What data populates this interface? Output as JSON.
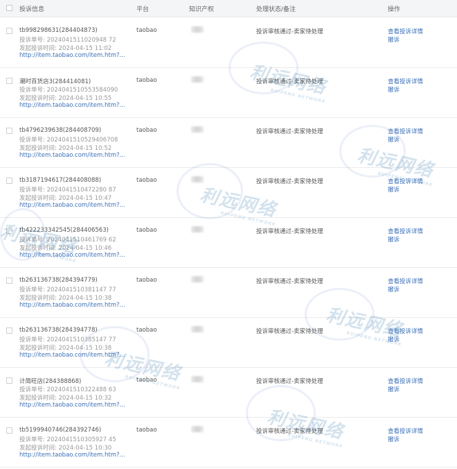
{
  "header": {
    "col_info": "投诉信息",
    "col_platform": "平台",
    "col_ip": "知识产权",
    "col_status": "处理状态/备注",
    "col_action": "操作"
  },
  "watermark": {
    "text": "利远网络",
    "sub": "RUIPENG NETWORK"
  },
  "rows": [
    {
      "shop": "tb998298631(284404873)",
      "no": "投诉单号: 2024041511020948 72",
      "time": "发起投诉时间: 2024-04-15 11:02",
      "link": "http://item.taobao.com/item.htm?...",
      "platform": "taobao",
      "status": "投诉审核通过-卖家待处理",
      "detail": "查看投诉详情",
      "revoke": "撤诉"
    },
    {
      "shop": "潮时百货店3(284414081)",
      "no": "投诉单号: 2024041510553584090",
      "time": "发起投诉时间: 2024-04-15 10:55",
      "link": "http://item.taobao.com/item.htm?...",
      "platform": "taobao",
      "status": "投诉审核通过-卖家待处理",
      "detail": "查看投诉详情",
      "revoke": "撤诉"
    },
    {
      "shop": "tb4796239638(284408709)",
      "no": "投诉单号: 2024041510529406708",
      "time": "发起投诉时间: 2024-04-15 10:52",
      "link": "http://item.taobao.com/item.htm?...",
      "platform": "taobao",
      "status": "投诉审核通过-卖家待处理",
      "detail": "查看投诉详情",
      "revoke": "撤诉"
    },
    {
      "shop": "tb3187194617(284408088)",
      "no": "投诉单号: 2024041510472280 87",
      "time": "发起投诉时间: 2024-04-15 10:47",
      "link": "http://item.taobao.com/item.htm?...",
      "platform": "taobao",
      "status": "投诉审核通过-卖家待处理",
      "detail": "查看投诉详情",
      "revoke": "撤诉"
    },
    {
      "shop": "tb422233342545(284406563)",
      "no": "投诉单号: 2024041510461769 62",
      "time": "发起投诉时间: 2024-04-15 10:46",
      "link": "http://item.taobao.com/item.htm?...",
      "platform": "taobao",
      "status": "投诉审核通过-卖家待处理",
      "detail": "查看投诉详情",
      "revoke": "撤诉"
    },
    {
      "shop": "tb263136738(284394779)",
      "no": "投诉单号: 2024041510381147 77",
      "time": "发起投诉时间: 2024-04-15 10:38",
      "link": "http://item.taobao.com/item.htm?...",
      "platform": "taobao",
      "status": "投诉审核通过-卖家待处理",
      "detail": "查看投诉详情",
      "revoke": "撤诉"
    },
    {
      "shop": "tb263136738(284394778)",
      "no": "投诉单号: 2024041510385147 77",
      "time": "发起投诉时间: 2024-04-15 10:38",
      "link": "http://item.taobao.com/item.htm?...",
      "platform": "taobao",
      "status": "投诉审核通过-卖家待处理",
      "detail": "查看投诉详情",
      "revoke": "撤诉"
    },
    {
      "shop": "计简旺店(284388868)",
      "no": "投诉单号: 2024041510322488 63",
      "time": "发起投诉时间: 2024-04-15 10:32",
      "link": "http://item.taobao.com/item.htm?...",
      "platform": "taobao",
      "status": "投诉审核通过-卖家待处理",
      "detail": "查看投诉详情",
      "revoke": "撤诉"
    },
    {
      "shop": "tb5199940746(284392746)",
      "no": "投诉单号: 2024041510305927 45",
      "time": "发起投诉时间: 2024-04-15 10:30",
      "link": "http://item.taobao.com/item.htm?...",
      "platform": "taobao",
      "status": "投诉审核通过-卖家待处理",
      "detail": "查看投诉详情",
      "revoke": "撤诉"
    }
  ]
}
